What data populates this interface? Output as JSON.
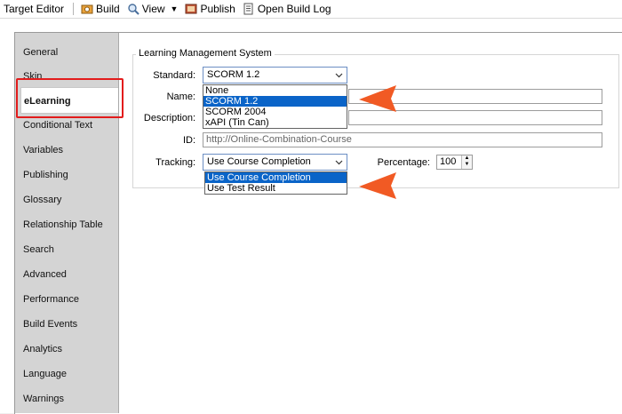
{
  "toolbar": {
    "title": "Target Editor",
    "build_label": "Build",
    "view_label": "View",
    "publish_label": "Publish",
    "open_build_log_label": "Open Build Log"
  },
  "sidebar": {
    "items": [
      {
        "label": "General"
      },
      {
        "label": "Skin"
      },
      {
        "label": "eLearning"
      },
      {
        "label": "Conditional Text"
      },
      {
        "label": "Variables"
      },
      {
        "label": "Publishing"
      },
      {
        "label": "Glossary"
      },
      {
        "label": "Relationship Table"
      },
      {
        "label": "Search"
      },
      {
        "label": "Advanced"
      },
      {
        "label": "Performance"
      },
      {
        "label": "Build Events"
      },
      {
        "label": "Analytics"
      },
      {
        "label": "Language"
      },
      {
        "label": "Warnings"
      }
    ],
    "active": "eLearning"
  },
  "lms": {
    "group_title": "Learning Management System",
    "standard_label": "Standard:",
    "standard_value": "SCORM 1.2",
    "standard_options": [
      "None",
      "SCORM 1.2",
      "SCORM 2004",
      "xAPI (Tin Can)"
    ],
    "name_label": "Name:",
    "name_value": "",
    "description_label": "Description:",
    "description_value": "",
    "id_label": "ID:",
    "id_value": "http://Online-Combination-Course",
    "tracking_label": "Tracking:",
    "tracking_value": "Use Course Completion",
    "tracking_options": [
      "Use Course Completion",
      "Use Test Result"
    ],
    "percentage_label": "Percentage:",
    "percentage_value": "100"
  },
  "colors": {
    "highlight": "#e21c1c",
    "callout_arrow": "#f15a24",
    "selection": "#0a64c8"
  }
}
